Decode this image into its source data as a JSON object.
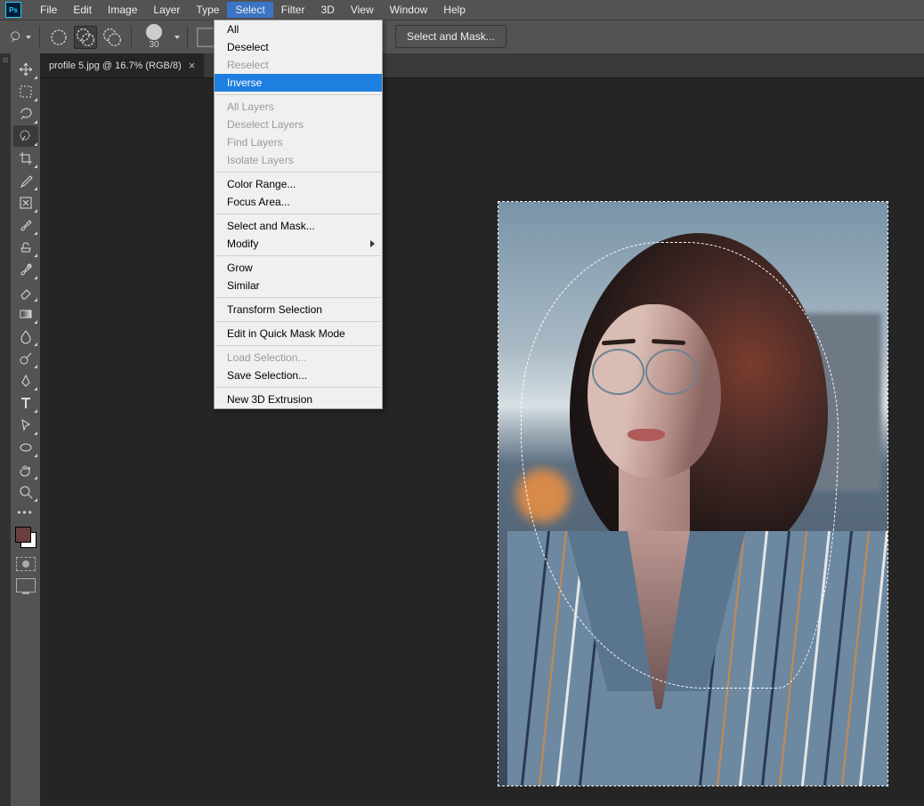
{
  "app": {
    "logo_text": "Ps"
  },
  "menubar": [
    "File",
    "Edit",
    "Image",
    "Layer",
    "Type",
    "Select",
    "Filter",
    "3D",
    "View",
    "Window",
    "Help"
  ],
  "menubar_open_index": 5,
  "optionbar": {
    "brush_size": "30",
    "select_mask_btn": "Select and Mask..."
  },
  "document": {
    "tab_label": "profile 5.jpg @ 16.7% (RGB/8)",
    "tab_close": "×"
  },
  "swatches": {
    "fg": "#6b3e3e",
    "bg": "#ffffff"
  },
  "dropdown": {
    "groups": [
      [
        {
          "label": "All",
          "enabled": true
        },
        {
          "label": "Deselect",
          "enabled": true
        },
        {
          "label": "Reselect",
          "enabled": false
        },
        {
          "label": "Inverse",
          "enabled": true,
          "highlight": true
        }
      ],
      [
        {
          "label": "All Layers",
          "enabled": false
        },
        {
          "label": "Deselect Layers",
          "enabled": false
        },
        {
          "label": "Find Layers",
          "enabled": false
        },
        {
          "label": "Isolate Layers",
          "enabled": false
        }
      ],
      [
        {
          "label": "Color Range...",
          "enabled": true
        },
        {
          "label": "Focus Area...",
          "enabled": true
        }
      ],
      [
        {
          "label": "Select and Mask...",
          "enabled": true
        },
        {
          "label": "Modify",
          "enabled": true,
          "submenu": true
        }
      ],
      [
        {
          "label": "Grow",
          "enabled": true
        },
        {
          "label": "Similar",
          "enabled": true
        }
      ],
      [
        {
          "label": "Transform Selection",
          "enabled": true
        }
      ],
      [
        {
          "label": "Edit in Quick Mask Mode",
          "enabled": true
        }
      ],
      [
        {
          "label": "Load Selection...",
          "enabled": false
        },
        {
          "label": "Save Selection...",
          "enabled": true
        }
      ],
      [
        {
          "label": "New 3D Extrusion",
          "enabled": true
        }
      ]
    ]
  },
  "tools": [
    {
      "name": "move-tool"
    },
    {
      "name": "rect-marquee-tool"
    },
    {
      "name": "lasso-tool"
    },
    {
      "name": "quick-select-tool",
      "selected": true
    },
    {
      "name": "crop-tool"
    },
    {
      "name": "eyedropper-tool"
    },
    {
      "name": "healing-brush-tool"
    },
    {
      "name": "brush-tool"
    },
    {
      "name": "clone-stamp-tool"
    },
    {
      "name": "history-brush-tool"
    },
    {
      "name": "eraser-tool"
    },
    {
      "name": "gradient-tool"
    },
    {
      "name": "blur-tool"
    },
    {
      "name": "dodge-tool"
    },
    {
      "name": "pen-tool"
    },
    {
      "name": "type-tool"
    },
    {
      "name": "path-select-tool"
    },
    {
      "name": "ellipse-tool"
    },
    {
      "name": "hand-tool"
    },
    {
      "name": "zoom-tool"
    }
  ]
}
